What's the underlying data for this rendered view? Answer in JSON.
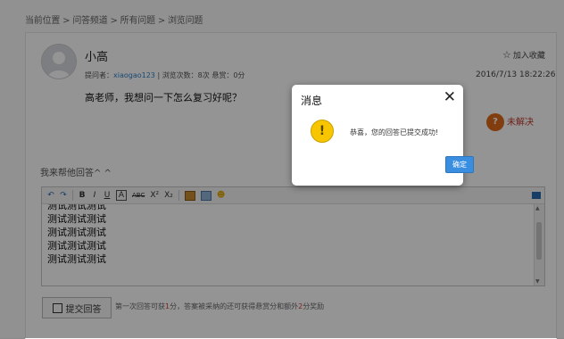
{
  "breadcrumb": "当前位置 > 问答频道 > 所有问题 > 浏览问题",
  "post": {
    "username": "小高",
    "meta_prefix": "提问者：",
    "meta_user": "xiaogao123",
    "meta_suffix": " | 浏览次数：8次 悬赏：0分",
    "favorite_label": "加入收藏",
    "date": "2016/7/13 18:22:26",
    "question": "高老师，我想问一下怎么复习好呢？",
    "status": "未解决"
  },
  "answer_section": {
    "label": "我来帮他回答^ ^",
    "editor_lines": [
      "测试测试测试",
      "测试测试测试",
      "测试测试测试",
      "测试测试测试",
      "测试测试测试"
    ],
    "submit_label": "提交回答",
    "hint_prefix": "第一次回答可获",
    "hint_num1": "1",
    "hint_mid": "分，答案被采纳的还可获得悬赏分和额外",
    "hint_num2": "2",
    "hint_suffix": "分奖励"
  },
  "toolbar": {
    "undo": "↶",
    "redo": "↷",
    "bold": "B",
    "italic": "I",
    "underline": "U",
    "font": "A",
    "strike": "ABC",
    "sup": "X²",
    "sub": "X₂",
    "emoji": "☻"
  },
  "dialog": {
    "title": "消息",
    "close": "✕",
    "icon": "!",
    "message": "恭喜，您的回答已提交成功!",
    "ok_label": "确定"
  }
}
